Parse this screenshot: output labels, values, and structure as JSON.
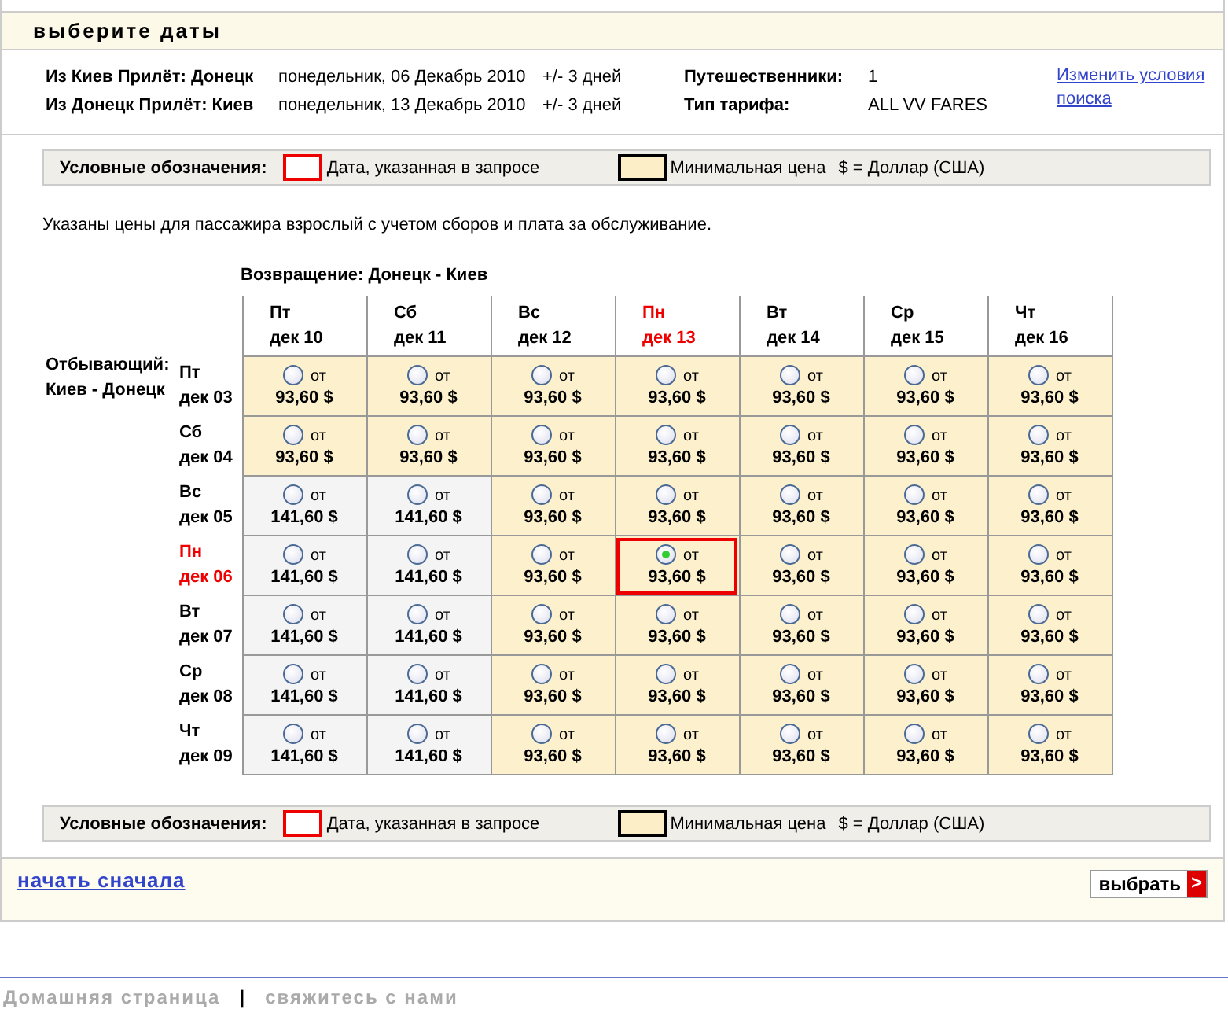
{
  "header": {
    "title": "выберите даты"
  },
  "itinerary": [
    {
      "route": "Из Киев Прилёт: Донецк",
      "date": "понедельник, 06 Декабрь 2010",
      "flex": "+/- 3 дней"
    },
    {
      "route": "Из Донецк Прилёт: Киев",
      "date": "понедельник, 13 Декабрь 2010",
      "flex": "+/- 3 дней"
    }
  ],
  "summary": [
    {
      "label": "Путешественники:",
      "value": "1"
    },
    {
      "label": "Тип тарифа:",
      "value": "ALL VV FARES"
    }
  ],
  "modify_link": "Изменить условия поиска",
  "legends": [
    {
      "title": "Условные обозначения:",
      "requested": "Дата, указанная в запросе",
      "minimum": "Минимальная цена",
      "currency": "$  = Доллар (США)"
    },
    {
      "title": "Условные обозначения:",
      "requested": "Дата, указанная в запросе",
      "minimum": "Минимальная цена",
      "currency": "$  = Доллар (США)"
    }
  ],
  "note": "Указаны цены для пассажира взрослый с учетом сборов и плата за обслуживание.",
  "grid": {
    "return_title": "Возвращение: Донецк - Киев",
    "depart_title": "Отбывающий: Киев - Донецк",
    "columns": [
      {
        "day": "Пт",
        "date": "дек 10",
        "requested": false
      },
      {
        "day": "Сб",
        "date": "дек 11",
        "requested": false
      },
      {
        "day": "Вс",
        "date": "дек 12",
        "requested": false
      },
      {
        "day": "Пн",
        "date": "дек 13",
        "requested": true
      },
      {
        "day": "Вт",
        "date": "дек 14",
        "requested": false
      },
      {
        "day": "Ср",
        "date": "дек 15",
        "requested": false
      },
      {
        "day": "Чт",
        "date": "дек 16",
        "requested": false
      }
    ],
    "rows": [
      {
        "day": "Пт",
        "date": "дек 03",
        "requested": false,
        "cells": [
          {
            "kind": "min",
            "label": "от",
            "price": "93,60 $",
            "selected": false,
            "requested": false
          },
          {
            "kind": "min",
            "label": "от",
            "price": "93,60 $",
            "selected": false,
            "requested": false
          },
          {
            "kind": "min",
            "label": "от",
            "price": "93,60 $",
            "selected": false,
            "requested": false
          },
          {
            "kind": "min",
            "label": "от",
            "price": "93,60 $",
            "selected": false,
            "requested": false
          },
          {
            "kind": "min",
            "label": "от",
            "price": "93,60 $",
            "selected": false,
            "requested": false
          },
          {
            "kind": "min",
            "label": "от",
            "price": "93,60 $",
            "selected": false,
            "requested": false
          },
          {
            "kind": "min",
            "label": "от",
            "price": "93,60 $",
            "selected": false,
            "requested": false
          }
        ]
      },
      {
        "day": "Сб",
        "date": "дек 04",
        "requested": false,
        "cells": [
          {
            "kind": "min",
            "label": "от",
            "price": "93,60 $",
            "selected": false,
            "requested": false
          },
          {
            "kind": "min",
            "label": "от",
            "price": "93,60 $",
            "selected": false,
            "requested": false
          },
          {
            "kind": "min",
            "label": "от",
            "price": "93,60 $",
            "selected": false,
            "requested": false
          },
          {
            "kind": "min",
            "label": "от",
            "price": "93,60 $",
            "selected": false,
            "requested": false
          },
          {
            "kind": "min",
            "label": "от",
            "price": "93,60 $",
            "selected": false,
            "requested": false
          },
          {
            "kind": "min",
            "label": "от",
            "price": "93,60 $",
            "selected": false,
            "requested": false
          },
          {
            "kind": "min",
            "label": "от",
            "price": "93,60 $",
            "selected": false,
            "requested": false
          }
        ]
      },
      {
        "day": "Вс",
        "date": "дек 05",
        "requested": false,
        "cells": [
          {
            "kind": "regular",
            "label": "от",
            "price": "141,60 $",
            "selected": false,
            "requested": false
          },
          {
            "kind": "regular",
            "label": "от",
            "price": "141,60 $",
            "selected": false,
            "requested": false
          },
          {
            "kind": "min",
            "label": "от",
            "price": "93,60 $",
            "selected": false,
            "requested": false
          },
          {
            "kind": "min",
            "label": "от",
            "price": "93,60 $",
            "selected": false,
            "requested": false
          },
          {
            "kind": "min",
            "label": "от",
            "price": "93,60 $",
            "selected": false,
            "requested": false
          },
          {
            "kind": "min",
            "label": "от",
            "price": "93,60 $",
            "selected": false,
            "requested": false
          },
          {
            "kind": "min",
            "label": "от",
            "price": "93,60 $",
            "selected": false,
            "requested": false
          }
        ]
      },
      {
        "day": "Пн",
        "date": "дек 06",
        "requested": true,
        "cells": [
          {
            "kind": "regular",
            "label": "от",
            "price": "141,60 $",
            "selected": false,
            "requested": false
          },
          {
            "kind": "regular",
            "label": "от",
            "price": "141,60 $",
            "selected": false,
            "requested": false
          },
          {
            "kind": "min",
            "label": "от",
            "price": "93,60 $",
            "selected": false,
            "requested": false
          },
          {
            "kind": "min",
            "label": "от",
            "price": "93,60 $",
            "selected": true,
            "requested": true
          },
          {
            "kind": "min",
            "label": "от",
            "price": "93,60 $",
            "selected": false,
            "requested": false
          },
          {
            "kind": "min",
            "label": "от",
            "price": "93,60 $",
            "selected": false,
            "requested": false
          },
          {
            "kind": "min",
            "label": "от",
            "price": "93,60 $",
            "selected": false,
            "requested": false
          }
        ]
      },
      {
        "day": "Вт",
        "date": "дек 07",
        "requested": false,
        "cells": [
          {
            "kind": "regular",
            "label": "от",
            "price": "141,60 $",
            "selected": false,
            "requested": false
          },
          {
            "kind": "regular",
            "label": "от",
            "price": "141,60 $",
            "selected": false,
            "requested": false
          },
          {
            "kind": "min",
            "label": "от",
            "price": "93,60 $",
            "selected": false,
            "requested": false
          },
          {
            "kind": "min",
            "label": "от",
            "price": "93,60 $",
            "selected": false,
            "requested": false
          },
          {
            "kind": "min",
            "label": "от",
            "price": "93,60 $",
            "selected": false,
            "requested": false
          },
          {
            "kind": "min",
            "label": "от",
            "price": "93,60 $",
            "selected": false,
            "requested": false
          },
          {
            "kind": "min",
            "label": "от",
            "price": "93,60 $",
            "selected": false,
            "requested": false
          }
        ]
      },
      {
        "day": "Ср",
        "date": "дек 08",
        "requested": false,
        "cells": [
          {
            "kind": "regular",
            "label": "от",
            "price": "141,60 $",
            "selected": false,
            "requested": false
          },
          {
            "kind": "regular",
            "label": "от",
            "price": "141,60 $",
            "selected": false,
            "requested": false
          },
          {
            "kind": "min",
            "label": "от",
            "price": "93,60 $",
            "selected": false,
            "requested": false
          },
          {
            "kind": "min",
            "label": "от",
            "price": "93,60 $",
            "selected": false,
            "requested": false
          },
          {
            "kind": "min",
            "label": "от",
            "price": "93,60 $",
            "selected": false,
            "requested": false
          },
          {
            "kind": "min",
            "label": "от",
            "price": "93,60 $",
            "selected": false,
            "requested": false
          },
          {
            "kind": "min",
            "label": "от",
            "price": "93,60 $",
            "selected": false,
            "requested": false
          }
        ]
      },
      {
        "day": "Чт",
        "date": "дек 09",
        "requested": false,
        "cells": [
          {
            "kind": "regular",
            "label": "от",
            "price": "141,60 $",
            "selected": false,
            "requested": false
          },
          {
            "kind": "regular",
            "label": "от",
            "price": "141,60 $",
            "selected": false,
            "requested": false
          },
          {
            "kind": "min",
            "label": "от",
            "price": "93,60 $",
            "selected": false,
            "requested": false
          },
          {
            "kind": "min",
            "label": "от",
            "price": "93,60 $",
            "selected": false,
            "requested": false
          },
          {
            "kind": "min",
            "label": "от",
            "price": "93,60 $",
            "selected": false,
            "requested": false
          },
          {
            "kind": "min",
            "label": "от",
            "price": "93,60 $",
            "selected": false,
            "requested": false
          },
          {
            "kind": "min",
            "label": "от",
            "price": "93,60 $",
            "selected": false,
            "requested": false
          }
        ]
      }
    ]
  },
  "actions": {
    "restart_link": "начать сначала",
    "select_button": {
      "label": "выбрать",
      "arrow": ">"
    }
  },
  "site_footer": {
    "links": [
      "Домашняя страница",
      "свяжитесь с нами"
    ],
    "separator": "|"
  }
}
